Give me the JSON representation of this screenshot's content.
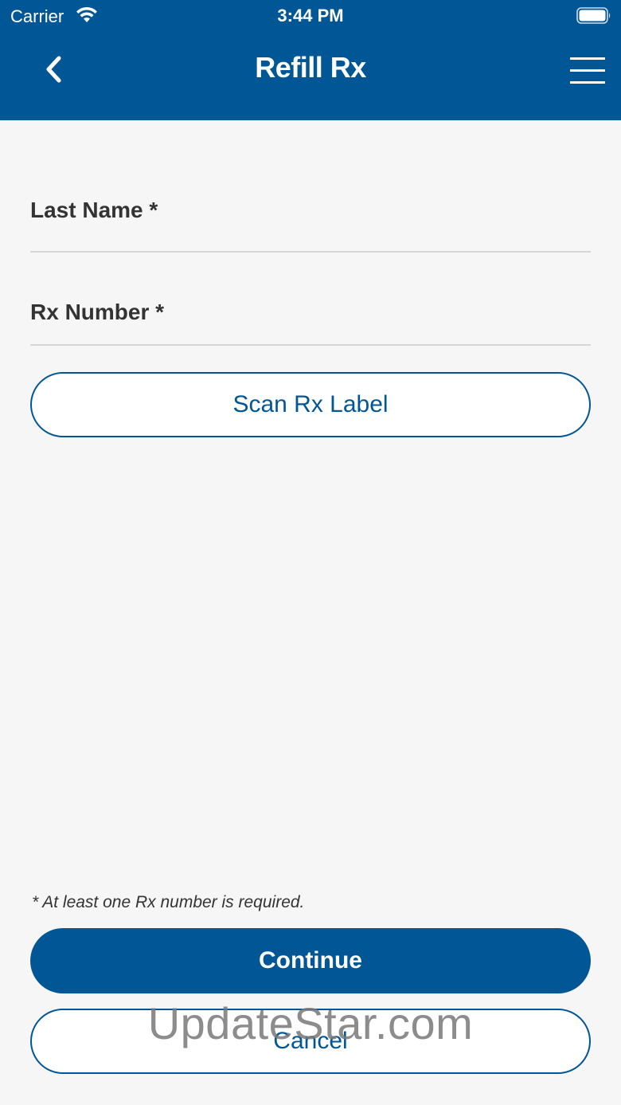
{
  "status_bar": {
    "carrier": "Carrier",
    "time": "3:44 PM",
    "icons": [
      "wifi-icon",
      "battery-icon"
    ]
  },
  "header": {
    "title": "Refill Rx",
    "back_icon": "chevron-left-icon",
    "menu_icon": "hamburger-menu-icon",
    "background": "#015695"
  },
  "form": {
    "last_name_label": "Last Name *",
    "last_name_value": "",
    "rx_number_label": "Rx Number *",
    "rx_number_value": ""
  },
  "buttons": {
    "scan_label": "Scan Rx Label",
    "continue_label": "Continue",
    "cancel_label": "Cancel"
  },
  "note": "* At least one Rx number is required.",
  "watermark": "UpdateStar.com",
  "colors": {
    "primary": "#015695",
    "background": "#f6f6f7",
    "divider": "#d6d6d8"
  }
}
